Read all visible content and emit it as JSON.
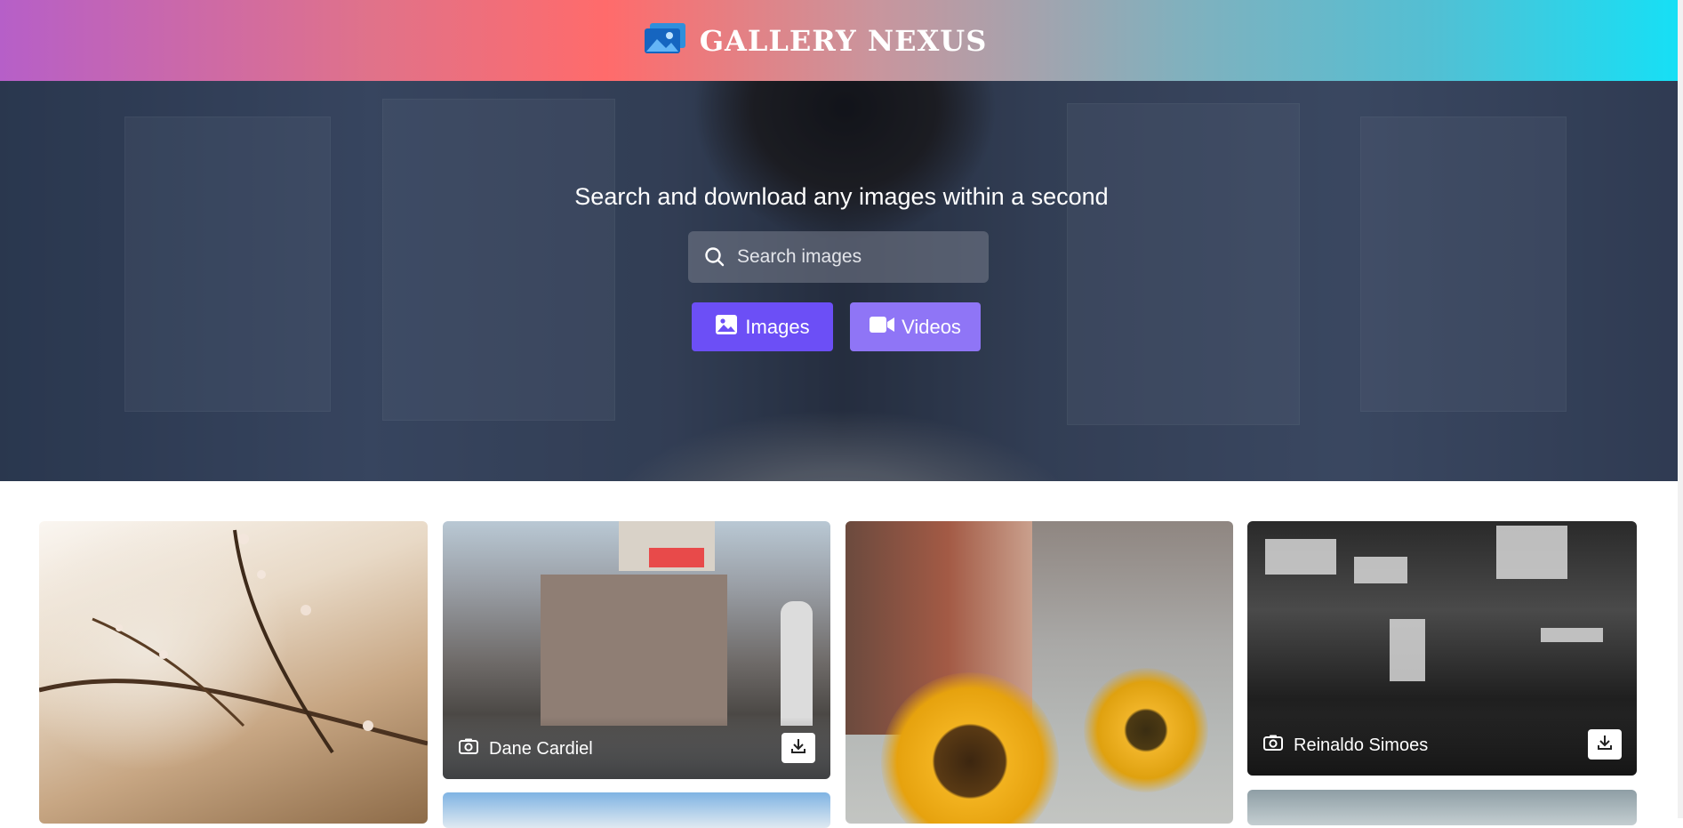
{
  "header": {
    "brand": "GALLERY NEXUS",
    "gradient_colors": [
      "#b65fc8",
      "#ff6b6b",
      "#15e0f6"
    ]
  },
  "hero": {
    "title": "Search and download any images within a second",
    "search": {
      "placeholder": "Search images",
      "value": ""
    },
    "buttons": [
      {
        "label": "Images",
        "icon": "image-icon",
        "color": "#6c4ff6"
      },
      {
        "label": "Videos",
        "icon": "video-camera-icon",
        "color": "#8f75f6"
      }
    ]
  },
  "gallery": {
    "cards": [
      {
        "photographer": "",
        "subject": "cherry blossom branches"
      },
      {
        "photographer": "Dane Cardiel",
        "subject": "city crossing with billboards"
      },
      {
        "photographer": "",
        "subject": "sunflowers in city street"
      },
      {
        "photographer": "Reinaldo Simoes",
        "subject": "black and white night city signs"
      }
    ],
    "download_icon": "download-icon",
    "photographer_icon": "camera-icon"
  }
}
